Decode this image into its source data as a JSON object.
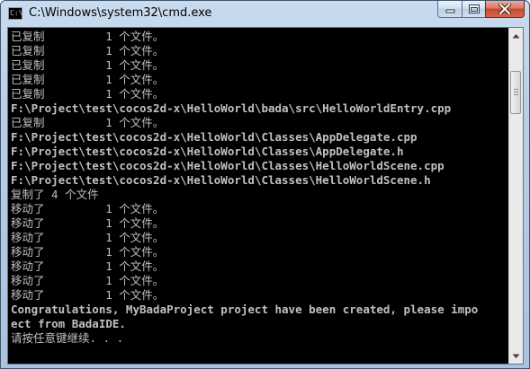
{
  "window": {
    "title": "C:\\Windows\\system32\\cmd.exe",
    "icon_label": "C:\\",
    "icon": "cmd-app-icon"
  },
  "caption_buttons": {
    "minimize_icon": "minimize-icon",
    "maximize_icon": "maximize-icon",
    "close_icon": "close-icon"
  },
  "console": {
    "foreground": "#c0c0c0",
    "background": "#000000",
    "lines": [
      "已复制         1 个文件。",
      "已复制         1 个文件。",
      "已复制         1 个文件。",
      "已复制         1 个文件。",
      "已复制         1 个文件。",
      "F:\\Project\\test\\cocos2d-x\\HelloWorld\\bada\\src\\HelloWorldEntry.cpp",
      "已复制         1 个文件。",
      "F:\\Project\\test\\cocos2d-x\\HelloWorld\\Classes\\AppDelegate.cpp",
      "F:\\Project\\test\\cocos2d-x\\HelloWorld\\Classes\\AppDelegate.h",
      "F:\\Project\\test\\cocos2d-x\\HelloWorld\\Classes\\HelloWorldScene.cpp",
      "F:\\Project\\test\\cocos2d-x\\HelloWorld\\Classes\\HelloWorldScene.h",
      "复制了 4 个文件",
      "移动了         1 个文件。",
      "移动了         1 个文件。",
      "移动了         1 个文件。",
      "移动了         1 个文件。",
      "移动了         1 个文件。",
      "移动了         1 个文件。",
      "移动了         1 个文件。",
      "Congratulations, MyBadaProject project have been created, please impo",
      "ect from BadaIDE.",
      "请按任意键继续. . ."
    ]
  }
}
